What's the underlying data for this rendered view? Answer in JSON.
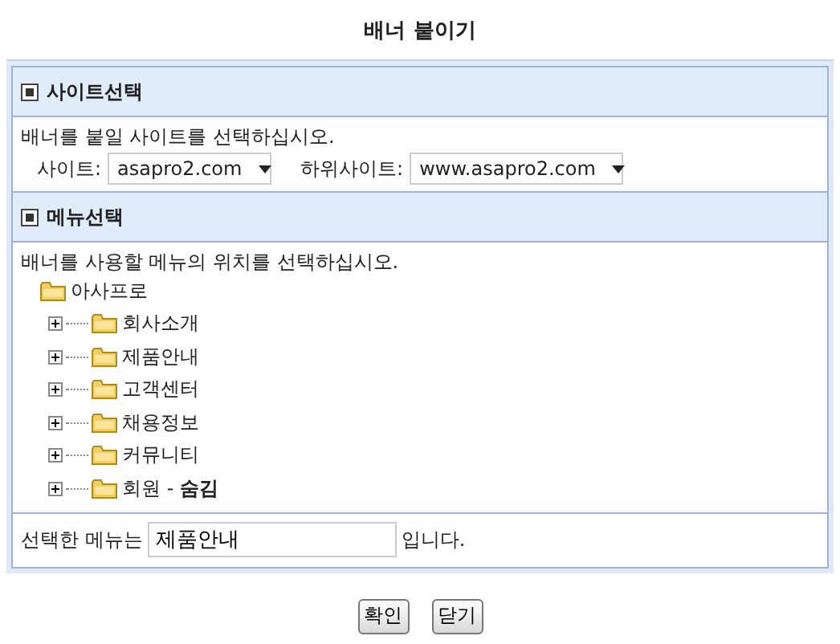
{
  "window": {
    "title": "배너 붙이기"
  },
  "site_section": {
    "title": "사이트선택",
    "instruction": "배너를 붙일 사이트를 선택하십시오.",
    "site_label": "사이트:",
    "site_value": "asapro2.com",
    "subsite_label": "하위사이트:",
    "subsite_value": "www.asapro2.com"
  },
  "menu_section": {
    "title": "메뉴선택",
    "instruction": "배너를 사용할 메뉴의 위치를 선택하십시오.",
    "tree": [
      {
        "label": "아사프로",
        "children": [
          {
            "label": "회사소개",
            "expanded": false
          },
          {
            "label": "제품안내",
            "expanded": false
          },
          {
            "label": "고객센터",
            "expanded": false
          },
          {
            "label": "채용정보",
            "expanded": false
          },
          {
            "label": "커뮤니티",
            "expanded": false
          },
          {
            "label": "회원 - **숨김**",
            "expanded": false
          }
        ]
      }
    ]
  },
  "selected_menu": {
    "prefix": "선택한 메뉴는",
    "value": "제품안내",
    "suffix": "입니다."
  },
  "buttons": [
    "확인",
    "닫기"
  ]
}
